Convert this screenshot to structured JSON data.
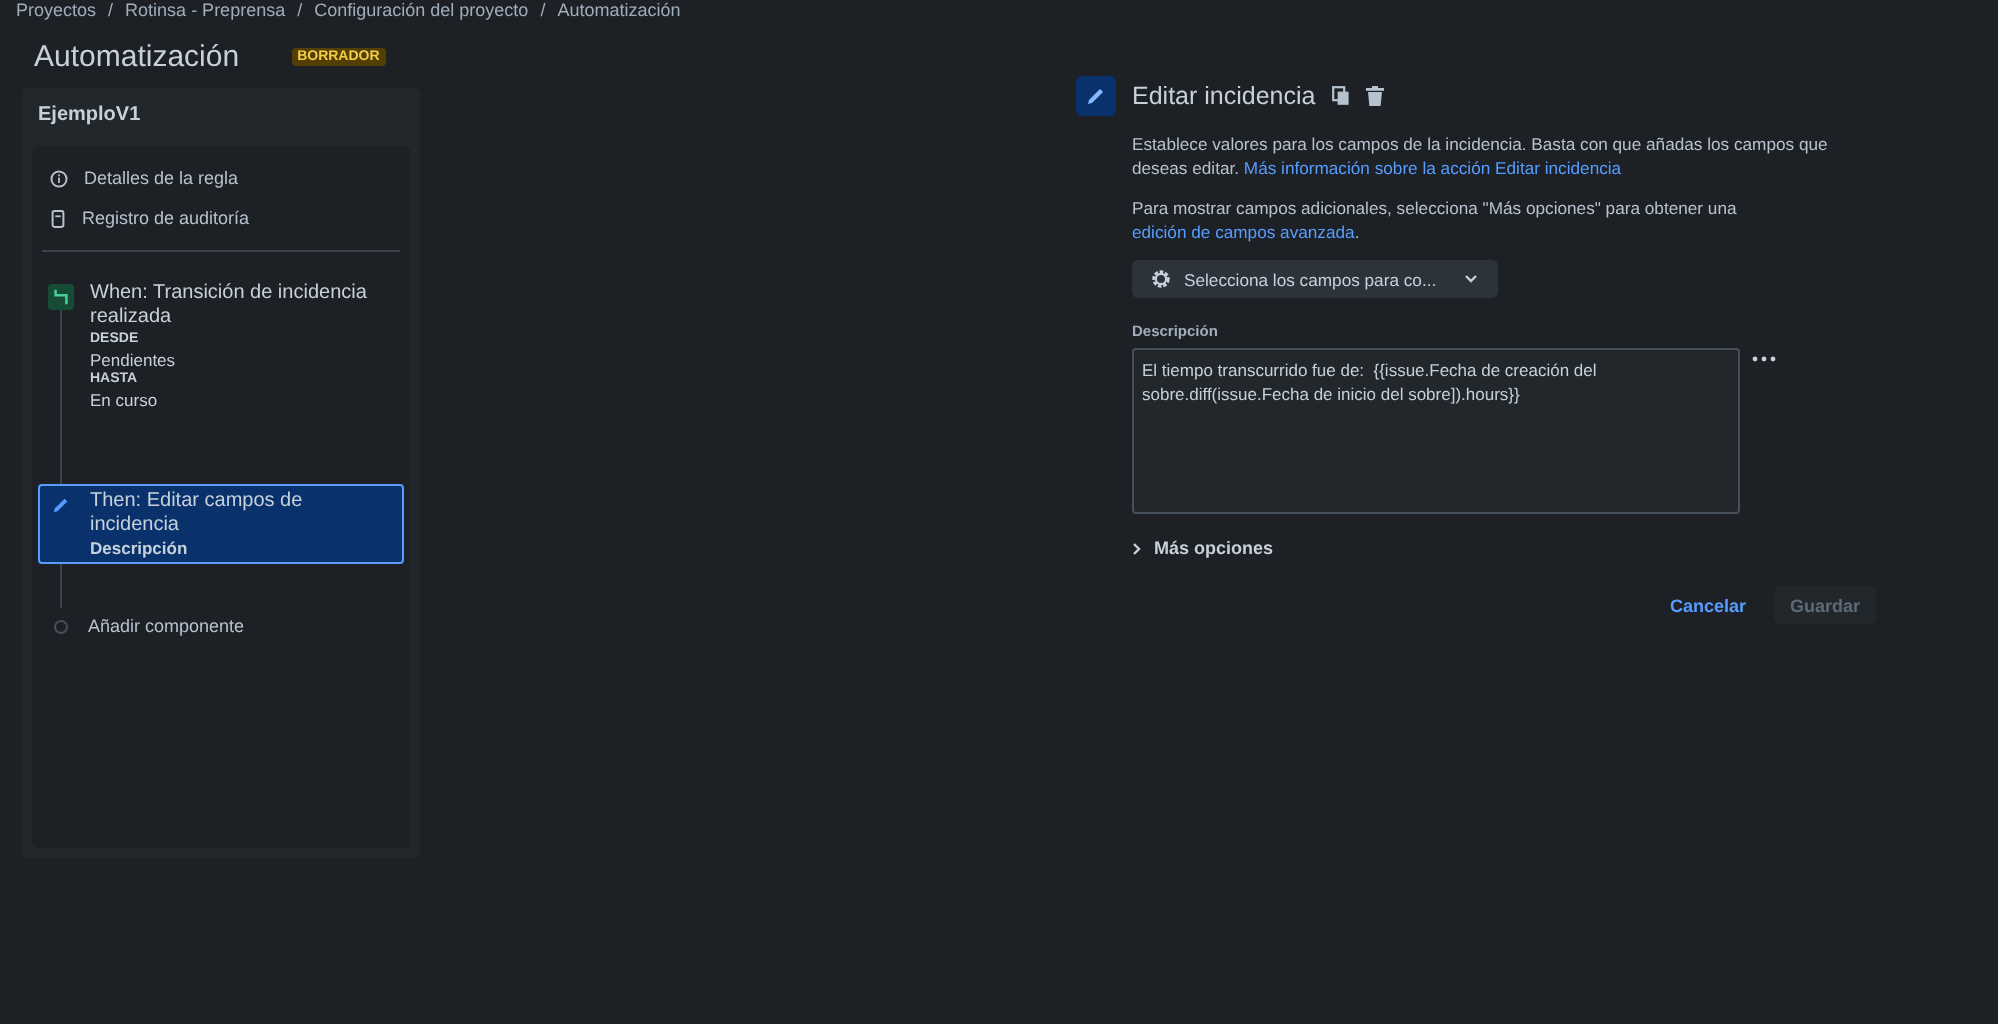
{
  "breadcrumbs": [
    "Proyectos",
    "Rotinsa - Preprensa",
    "Configuración del proyecto",
    "Automatización"
  ],
  "breadcrumb_separator": "/",
  "page": {
    "title": "Automatización",
    "badge": "BORRADOR"
  },
  "rule_panel": {
    "title": "EjemploV1",
    "links": [
      {
        "kind": "info",
        "label": "Detalles de la regla"
      },
      {
        "kind": "audit",
        "label": "Registro de auditoría"
      }
    ],
    "steps": [
      {
        "kind": "trigger",
        "title": "When: Transición de incidencia realizada",
        "selected": false,
        "details": [
          {
            "kind": "heading",
            "text": "DESDE"
          },
          {
            "kind": "value",
            "text": "Pendientes"
          },
          {
            "kind": "heading",
            "text": "HASTA"
          },
          {
            "kind": "value",
            "text": "En curso"
          }
        ]
      },
      {
        "kind": "action",
        "title": "Then: Editar campos de incidencia",
        "selected": true,
        "details": [
          {
            "kind": "field",
            "text": "Descripción"
          }
        ]
      }
    ],
    "add_component": "Añadir componente"
  },
  "editor": {
    "title": "Editar incidencia",
    "intro": "Establece valores para los campos de la incidencia. Basta con que añadas los campos que deseas editar.",
    "intro_link": "Más información sobre la acción Editar incidencia",
    "hint": "Para mostrar campos adicionales, selecciona \"Más opciones\" para obtener una",
    "hint_link": "edición de campos avanzada",
    "hint_end": ".",
    "field_picker": "Selecciona los campos para co...",
    "field": {
      "label": "Descripción",
      "value": "El tiempo transcurrido fue de:  {{issue.Fecha de creación del sobre.diff(issue.Fecha de inicio del sobre]).hours}}"
    },
    "more_options": {
      "label": "Más opciones",
      "expanded": false
    },
    "buttons": [
      {
        "kind": "link",
        "label": "Cancelar",
        "disabled": false
      },
      {
        "kind": "primary",
        "label": "Guardar",
        "disabled": true
      }
    ]
  }
}
